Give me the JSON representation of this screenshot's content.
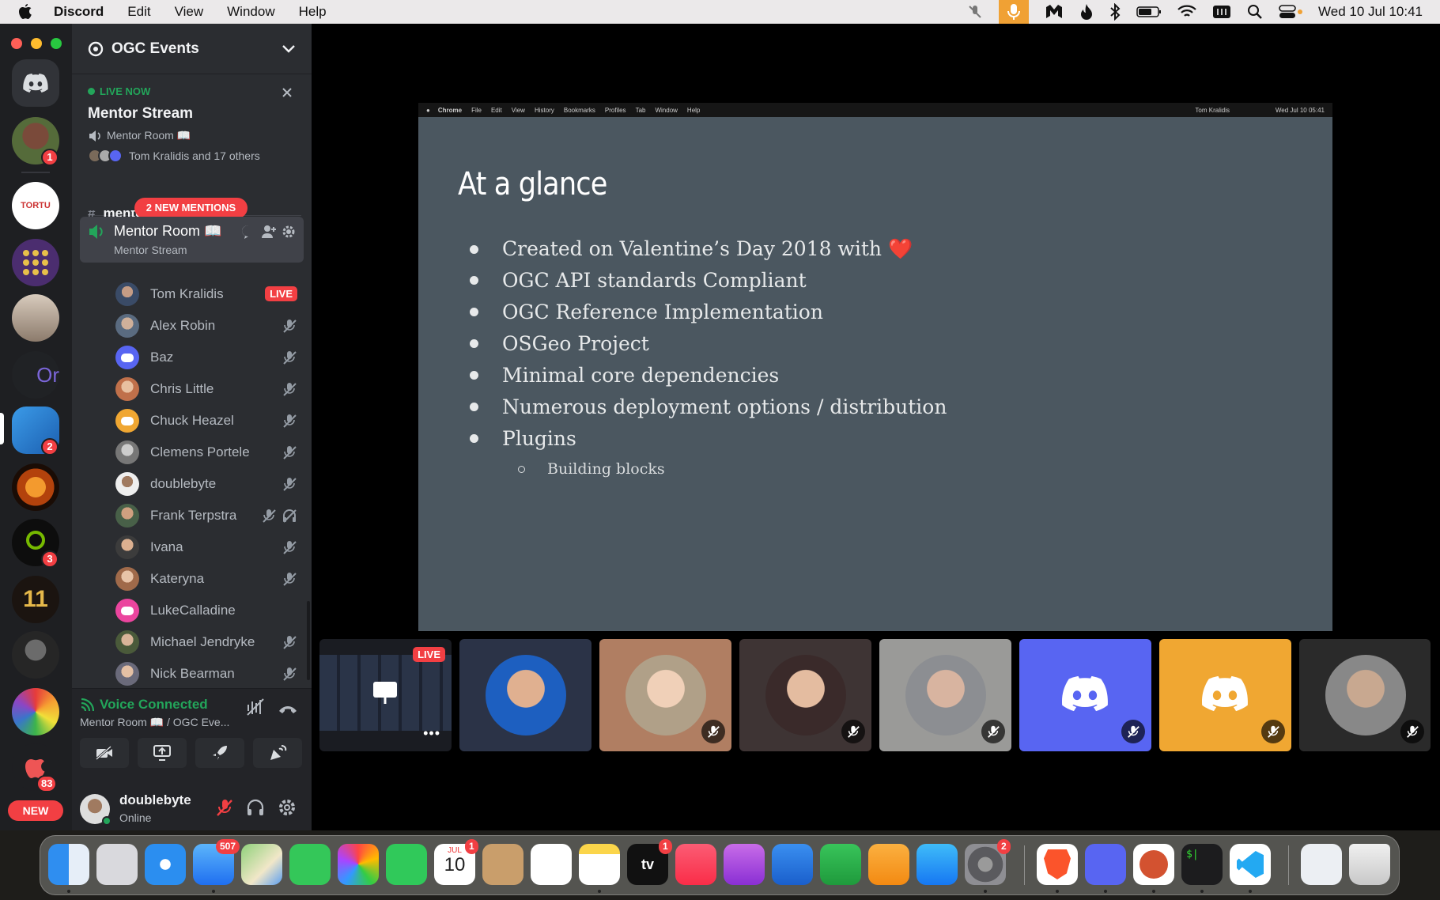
{
  "menubar": {
    "app": "Discord",
    "items": [
      "Edit",
      "View",
      "Window",
      "Help"
    ],
    "datetime": "Wed 10 Jul  10:41"
  },
  "server": {
    "name": "OGC Events",
    "badges": {
      "s1": "1",
      "s6": "2",
      "s9": "3",
      "s13": "83"
    },
    "new_label": "NEW"
  },
  "live_now": {
    "label": "LIVE NOW",
    "title": "Mentor Stream",
    "room": "Mentor Room 📖",
    "watchers": "Tom Kralidis and 17 others"
  },
  "channels": {
    "partial": "mentor-room-",
    "mentions_pill": "2 NEW MENTIONS",
    "voice_name": "Mentor Room 📖",
    "voice_sub": "Mentor Stream"
  },
  "members": [
    {
      "name": "Tom Kralidis",
      "live": "LIVE"
    },
    {
      "name": "Alex Robin"
    },
    {
      "name": "Baz"
    },
    {
      "name": "Chris Little"
    },
    {
      "name": "Chuck Heazel"
    },
    {
      "name": "Clemens Portele"
    },
    {
      "name": "doublebyte"
    },
    {
      "name": "Frank Terpstra"
    },
    {
      "name": "Ivana"
    },
    {
      "name": "Kateryna"
    },
    {
      "name": "LukeCalladine"
    },
    {
      "name": "Michael Jendryke"
    },
    {
      "name": "Nick Bearman"
    }
  ],
  "voice": {
    "status": "Voice Connected",
    "location": "Mentor Room 📖 / OGC Eve..."
  },
  "user": {
    "name": "doublebyte",
    "status": "Online"
  },
  "slide": {
    "chrome_menu": [
      "Chrome",
      "File",
      "Edit",
      "View",
      "History",
      "Bookmarks",
      "Profiles",
      "Tab",
      "Window",
      "Help"
    ],
    "chrome_right": "Tom Kralidis",
    "chrome_time": "Wed Jul 10  05:41",
    "title": "At a glance",
    "bullets": [
      "Created on Valentine’s Day 2018 with ❤️",
      "OGC API standards Compliant",
      "OGC Reference Implementation",
      "OSGeo Project",
      "Minimal core dependencies",
      "Numerous deployment options / distribution",
      "Plugins"
    ],
    "sub_bullet": "Building blocks"
  },
  "tiles": {
    "live_label": "LIVE"
  },
  "dock": {
    "mail_badge": "507",
    "cal_badge": "1",
    "cal_month": "JUL",
    "cal_day": "10",
    "tv_badge": "1",
    "settings_badge": "2",
    "terminal_prompt": "$|"
  },
  "colors": {
    "blurple": "#5865f2",
    "live_green": "#23a55a",
    "mention_red": "#f23f43",
    "slide_bg": "#4b5760"
  }
}
